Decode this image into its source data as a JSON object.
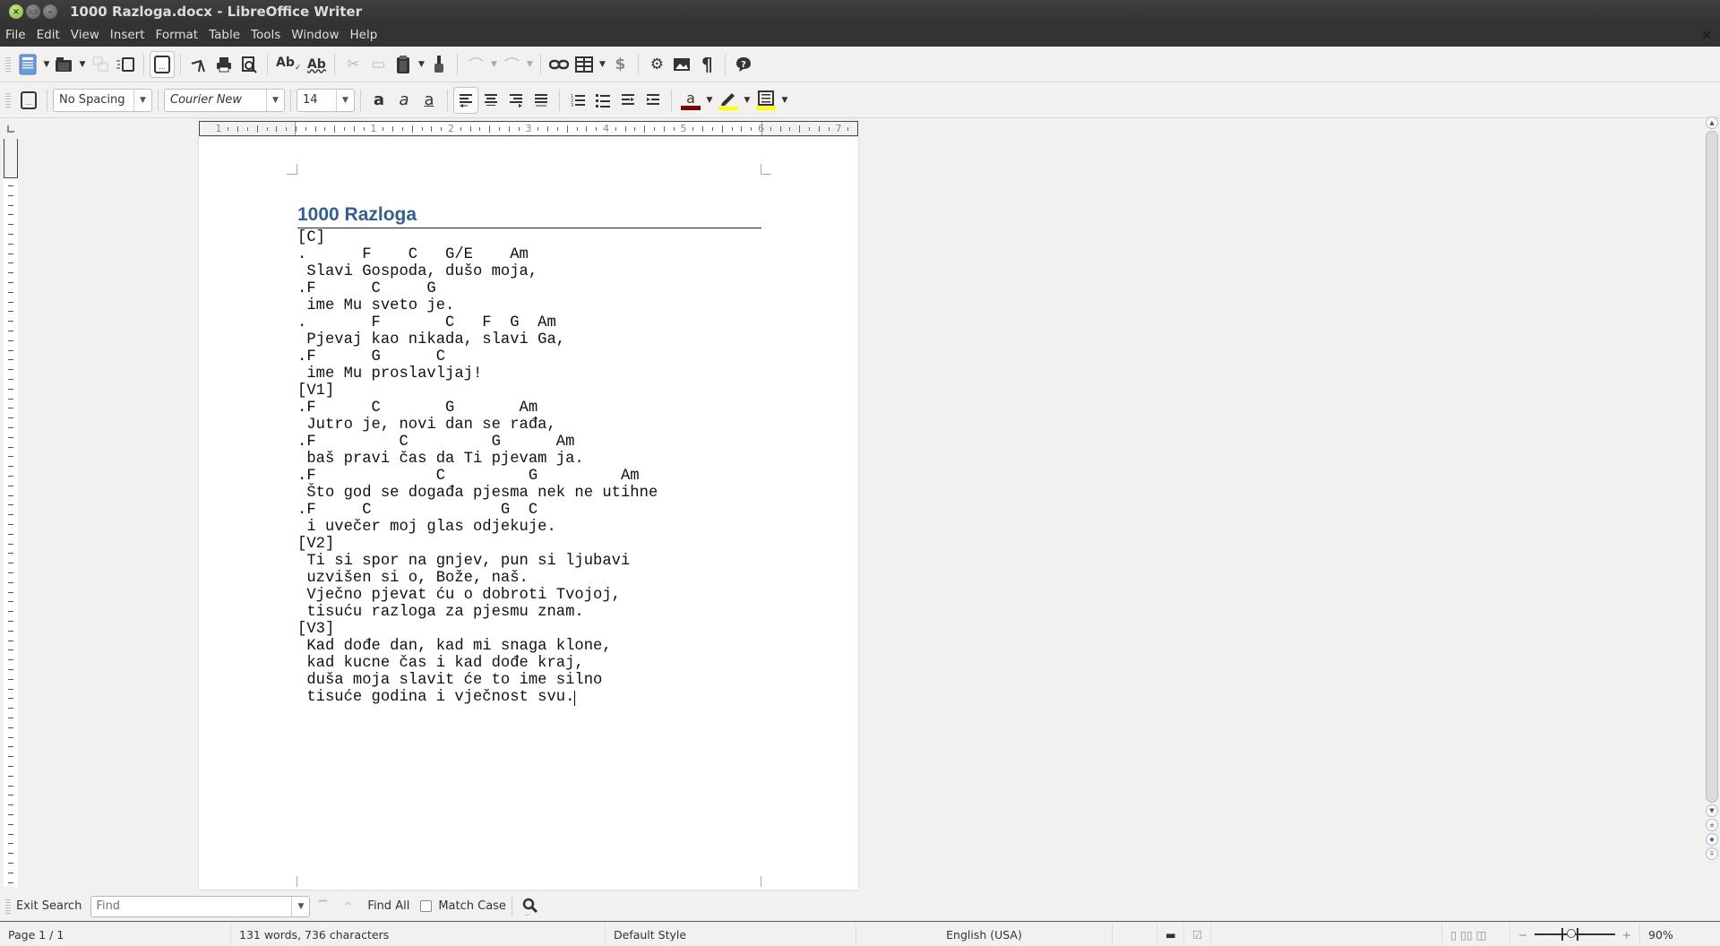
{
  "window": {
    "title": "1000 Razloga.docx - LibreOffice Writer",
    "close_label": "×",
    "doc_close_label": "×"
  },
  "menubar": {
    "items": [
      "File",
      "Edit",
      "View",
      "Insert",
      "Format",
      "Table",
      "Tools",
      "Window",
      "Help"
    ]
  },
  "standard_toolbar": {
    "icons": [
      "new-document",
      "open-folder",
      "save",
      "export-pdf-disabled",
      "toggle-edit",
      "print-preview-page",
      "cut",
      "print",
      "print-preview",
      "spelling",
      "auto-spellcheck",
      "copy-disabled",
      "paste-disabled",
      "paste",
      "clone-formatting",
      "undo",
      "redo",
      "hyperlink",
      "table",
      "track-changes",
      "settings",
      "insert-image",
      "formatting-marks",
      "comment"
    ]
  },
  "formatting_toolbar": {
    "paragraph_style": "No Spacing",
    "font_name": "Courier New",
    "font_size": "14",
    "font_color": "#7f0000",
    "highlight_color": "#ffff00",
    "border_color": "#ffff00",
    "alignment": "left"
  },
  "ruler": {
    "labels": [
      "1",
      "1",
      "2",
      "3",
      "4",
      "5",
      "6",
      "7"
    ]
  },
  "document": {
    "title": "1000 Razloga",
    "lines": [
      "[C]",
      ".      F    C   G/E    Am",
      " Slavi Gospoda, dušo moja,",
      ".F      C     G",
      " ime Mu sveto je.",
      ".       F       C   F  G  Am",
      " Pjevaj kao nikada, slavi Ga,",
      ".F      G      C",
      " ime Mu proslavljaj!",
      "[V1]",
      ".F      C       G       Am",
      " Jutro je, novi dan se rađa,",
      ".F         C         G      Am",
      " baš pravi čas da Ti pjevam ja.",
      ".F             C         G         Am",
      " Što god se događa pjesma nek ne utihne",
      ".F     C              G  C",
      " i uvečer moj glas odjekuje.",
      "[V2]",
      " Ti si spor na gnjev, pun si ljubavi",
      " uzvišen si o, Bože, naš.",
      " Vječno pjevat ću o dobroti Tvojoj,",
      " tisuću razloga za pjesmu znam.",
      "[V3]",
      " Kad dođe dan, kad mi snaga klone,",
      " kad kucne čas i kad dođe kraj,",
      " duša moja slavit će to ime silno",
      " tisuće godina i vječnost svu."
    ]
  },
  "findbar": {
    "exit_label": "Exit Search",
    "find_placeholder": "Find",
    "find_value": "",
    "find_all_label": "Find All",
    "match_case_label": "Match Case",
    "match_case_checked": false
  },
  "statusbar": {
    "page": "Page 1 / 1",
    "word_count": "131 words, 736 characters",
    "page_style": "Default Style",
    "language": "English (USA)",
    "zoom": "90%"
  }
}
